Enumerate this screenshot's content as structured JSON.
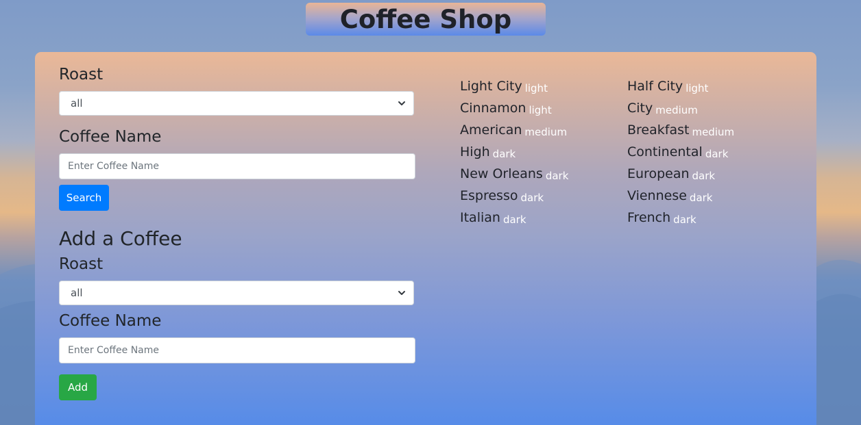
{
  "header": {
    "title": "Coffee Shop"
  },
  "search": {
    "roast_label": "Roast",
    "roast_value": "all",
    "name_label": "Coffee Name",
    "name_placeholder": "Enter Coffee Name",
    "button_label": "Search"
  },
  "add": {
    "heading": "Add a Coffee",
    "roast_label": "Roast",
    "roast_value": "all",
    "name_label": "Coffee Name",
    "name_placeholder": "Enter Coffee Name",
    "button_label": "Add"
  },
  "coffees": {
    "col1": [
      {
        "name": "Light City",
        "roast": "light"
      },
      {
        "name": "Cinnamon",
        "roast": "light"
      },
      {
        "name": "American",
        "roast": "medium"
      },
      {
        "name": "High",
        "roast": "dark"
      },
      {
        "name": "New Orleans",
        "roast": "dark"
      },
      {
        "name": "Espresso",
        "roast": "dark"
      },
      {
        "name": "Italian",
        "roast": "dark"
      }
    ],
    "col2": [
      {
        "name": "Half City",
        "roast": "light"
      },
      {
        "name": "City",
        "roast": "medium"
      },
      {
        "name": "Breakfast",
        "roast": "medium"
      },
      {
        "name": "Continental",
        "roast": "dark"
      },
      {
        "name": "European",
        "roast": "dark"
      },
      {
        "name": "Viennese",
        "roast": "dark"
      },
      {
        "name": "French",
        "roast": "dark"
      }
    ]
  },
  "colors": {
    "search_button": "#007bff",
    "add_button": "#28a745",
    "roast_text": "#ffffff"
  }
}
